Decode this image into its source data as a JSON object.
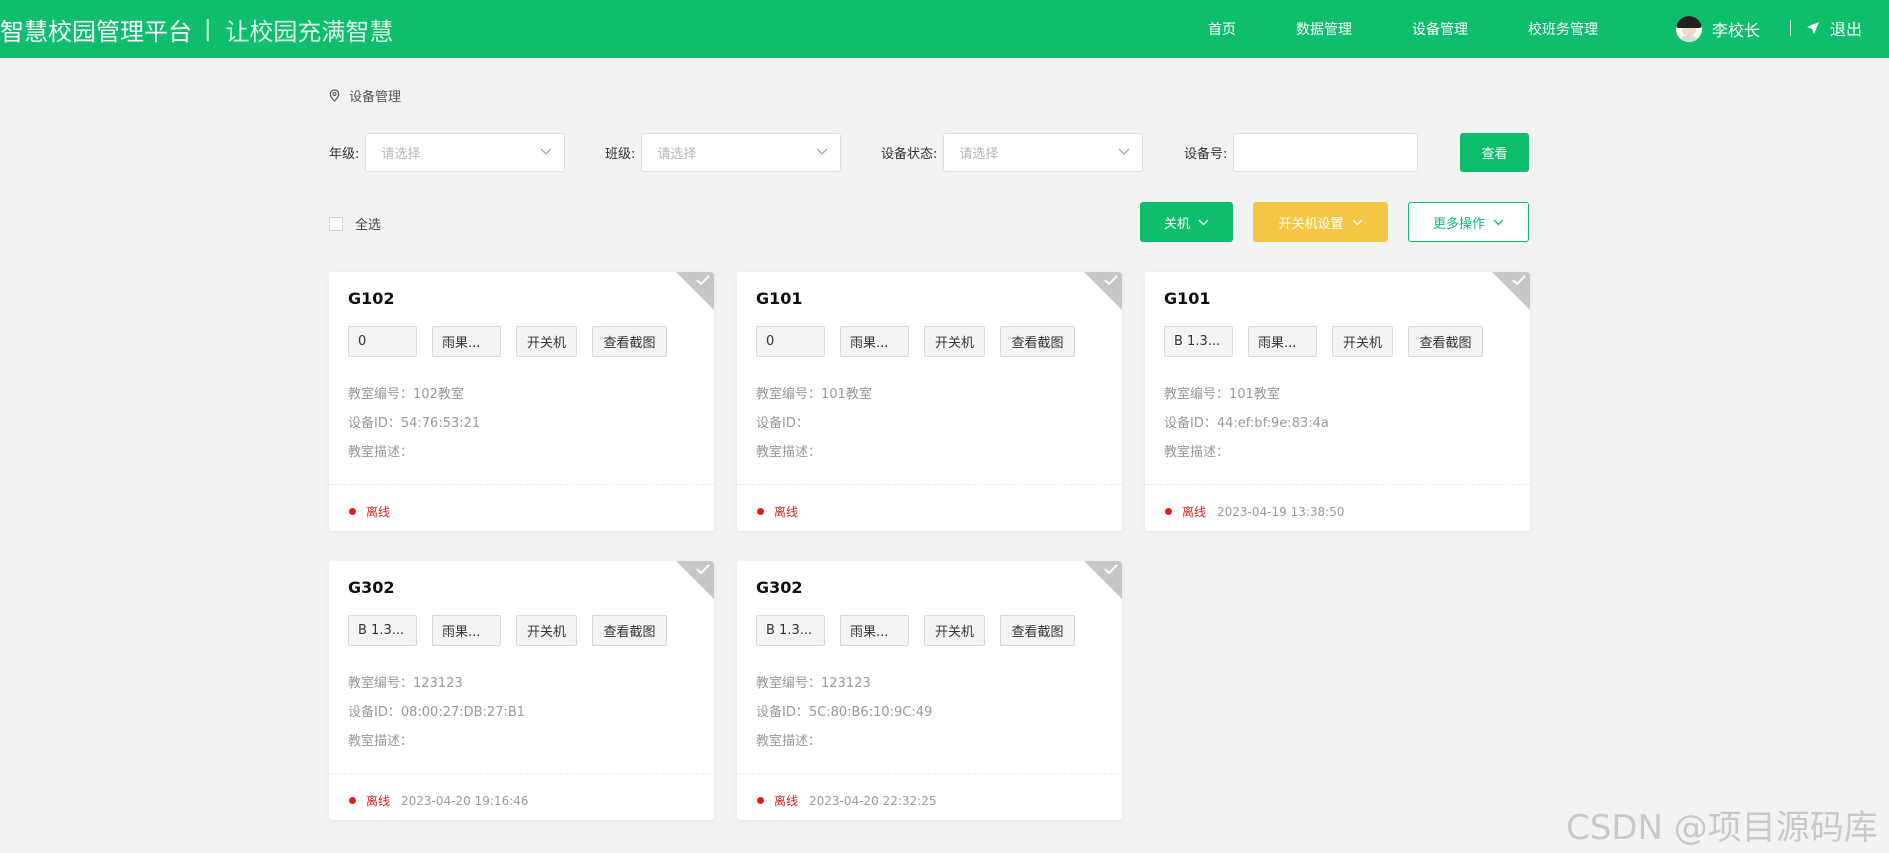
{
  "header": {
    "brand": "智慧校园管理平台",
    "separator": "|",
    "slogan": "让校园充满智慧",
    "nav": [
      "首页",
      "数据管理",
      "设备管理",
      "校班务管理"
    ],
    "user_name": "李校长",
    "logout": "退出",
    "accent_color": "#0ebe6c"
  },
  "breadcrumb": {
    "icon": "location-pin-icon",
    "text": "设备管理"
  },
  "filters": {
    "grade_label": "年级:",
    "grade_placeholder": "请选择",
    "class_label": "班级:",
    "class_placeholder": "请选择",
    "status_label": "设备状态:",
    "status_placeholder": "请选择",
    "device_label": "设备号:",
    "device_value": "",
    "query_button": "查看"
  },
  "toolbar": {
    "select_all": "全选",
    "shutdown_button": "关机",
    "power_schedule_button": "开关机设置",
    "more_button": "更多操作"
  },
  "labels": {
    "room_no": "教室编号：",
    "device_id": "设备ID：",
    "room_desc": "教室描述：",
    "offline": "离线"
  },
  "cards": [
    {
      "title": "G102",
      "chips": [
        "0",
        "雨果...",
        "开关机",
        "查看截图"
      ],
      "room_no": "102教室",
      "device_id": "54:76:53:21",
      "desc": "",
      "status": "离线",
      "time": ""
    },
    {
      "title": "G101",
      "chips": [
        "0",
        "雨果...",
        "开关机",
        "查看截图"
      ],
      "room_no": "101教室",
      "device_id": "",
      "desc": "",
      "status": "离线",
      "time": ""
    },
    {
      "title": "G101",
      "chips": [
        "B 1.3...",
        "雨果...",
        "开关机",
        "查看截图"
      ],
      "room_no": "101教室",
      "device_id": "44:ef:bf:9e:83:4a",
      "desc": "",
      "status": "离线",
      "time": "2023-04-19 13:38:50"
    },
    {
      "title": "G302",
      "chips": [
        "B 1.3...",
        "雨果...",
        "开关机",
        "查看截图"
      ],
      "room_no": "123123",
      "device_id": "08:00:27:DB:27:B1",
      "desc": "",
      "status": "离线",
      "time": "2023-04-20 19:16:46"
    },
    {
      "title": "G302",
      "chips": [
        "B 1.3...",
        "雨果...",
        "开关机",
        "查看截图"
      ],
      "room_no": "123123",
      "device_id": "5C:80:B6:10:9C:49",
      "desc": "",
      "status": "离线",
      "time": "2023-04-20 22:32:25"
    }
  ],
  "watermark": "CSDN @项目源码库"
}
